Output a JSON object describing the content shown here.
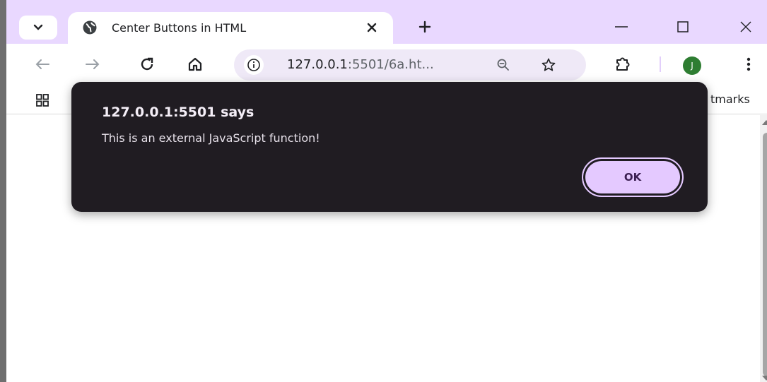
{
  "tab": {
    "title": "Center Buttons in HTML"
  },
  "omnibox": {
    "host": "127.0.0.1",
    "path": ":5501/6a.ht..."
  },
  "profile": {
    "initial": "J"
  },
  "bookmarks": {
    "label": "tmarks"
  },
  "dialog": {
    "title": "127.0.0.1:5501 says",
    "message": "This is an external JavaScript function!",
    "ok_label": "OK"
  },
  "colors": {
    "tabstrip": "#e9d8ff",
    "dialog_bg": "#201c22",
    "ok_button": "#e4c9ff",
    "avatar": "#2e7d32"
  }
}
